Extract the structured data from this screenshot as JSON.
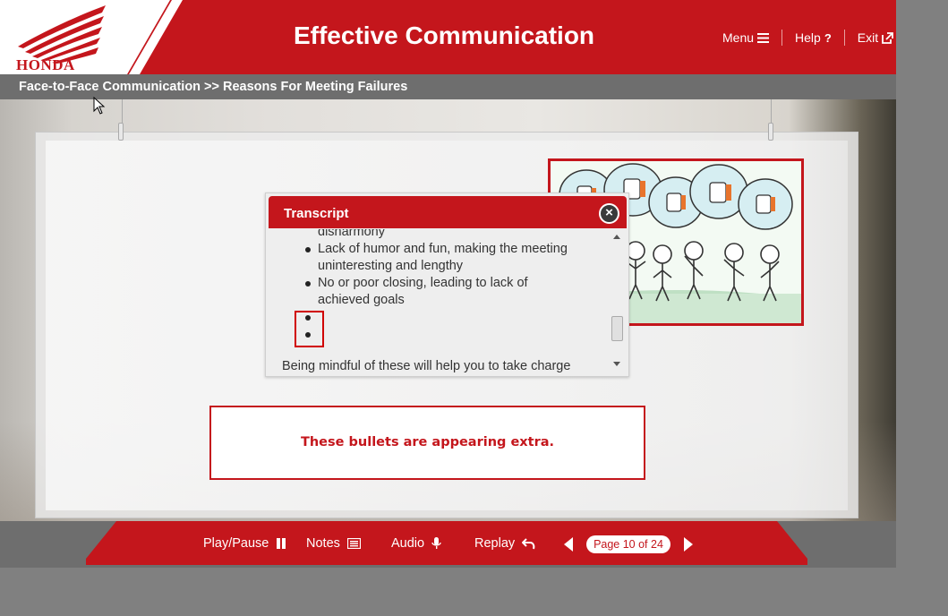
{
  "header": {
    "brand_logo_text": "HONDA",
    "title": "Effective Communication",
    "menu_label": "Menu",
    "help_label": "Help",
    "exit_label": "Exit"
  },
  "breadcrumb": "Face-to-Face Communication >> Reasons For Meeting Failures",
  "transcript": {
    "title": "Transcript",
    "close_glyph": "×",
    "lines": {
      "l0": "disharmony",
      "l1a": "Lack of humor and fun, making the meeting",
      "l1b": "uninteresting and lengthy",
      "l2a": "No or poor closing, leading to lack of",
      "l2b": "achieved goals",
      "l3": "Being mindful of these will help you to take charge"
    }
  },
  "annotation": {
    "note": "These bullets are appearing extra."
  },
  "footer": {
    "play_pause_label": "Play/Pause",
    "notes_label": "Notes",
    "audio_label": "Audio",
    "replay_label": "Replay",
    "page_indicator": "Page 10 of 24"
  },
  "colors": {
    "brand_red": "#c4161c",
    "bar_gray": "#6e6e6e",
    "annotation_red": "#d00000"
  },
  "icons": {
    "menu": "hamburger-icon",
    "help": "question-icon",
    "exit": "external-link-icon",
    "play_pause": "pause-icon",
    "notes": "notes-icon",
    "audio": "microphone-icon",
    "replay": "replay-icon",
    "prev": "prev-arrow-icon",
    "next": "next-arrow-icon",
    "close": "close-icon"
  }
}
